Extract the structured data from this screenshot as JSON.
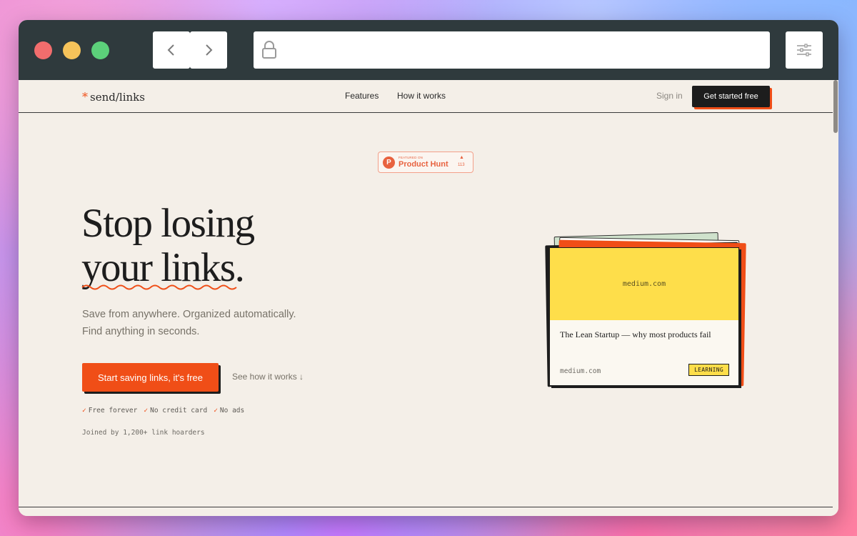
{
  "browser": {
    "traffic_lights": [
      "close",
      "minimize",
      "maximize"
    ],
    "url": "",
    "icons": {
      "back": "chevron-left-icon",
      "forward": "chevron-right-icon",
      "lock": "lock-icon",
      "menu": "sliders-icon"
    }
  },
  "site": {
    "logo_star": "*",
    "logo_text": "send/links",
    "nav": {
      "features": "Features",
      "how_it_works": "How it works"
    },
    "sign_in": "Sign in",
    "cta_top": "Get started free"
  },
  "badge": {
    "small_text": "FEATURED ON",
    "logo_letter": "P",
    "name": "Product Hunt",
    "arrow": "▲",
    "count": "113"
  },
  "hero": {
    "title_line1": "Stop losing",
    "title_line2": "your links.",
    "subtitle_line1": "Save from anywhere. Organized automatically.",
    "subtitle_line2": "Find anything in seconds.",
    "cta_main": "Start saving links, it's free",
    "secondary_link": "See how it works ↓",
    "checks": [
      {
        "tick": "✓",
        "label": "Free forever"
      },
      {
        "tick": "✓",
        "label": "No credit card"
      },
      {
        "tick": "✓",
        "label": "No ads"
      }
    ],
    "joined": "Joined by 1,200+ link hoarders"
  },
  "card": {
    "hero_domain": "medium.com",
    "title": "The Lean Startup — why most products fail",
    "domain": "medium.com",
    "tag": "LEARNING"
  },
  "colors": {
    "accent": "#f04e17",
    "dark": "#1d1d1d",
    "page_bg": "#f4efe8",
    "card_yellow": "#fede4a",
    "toolbar": "#2f3a3d"
  }
}
